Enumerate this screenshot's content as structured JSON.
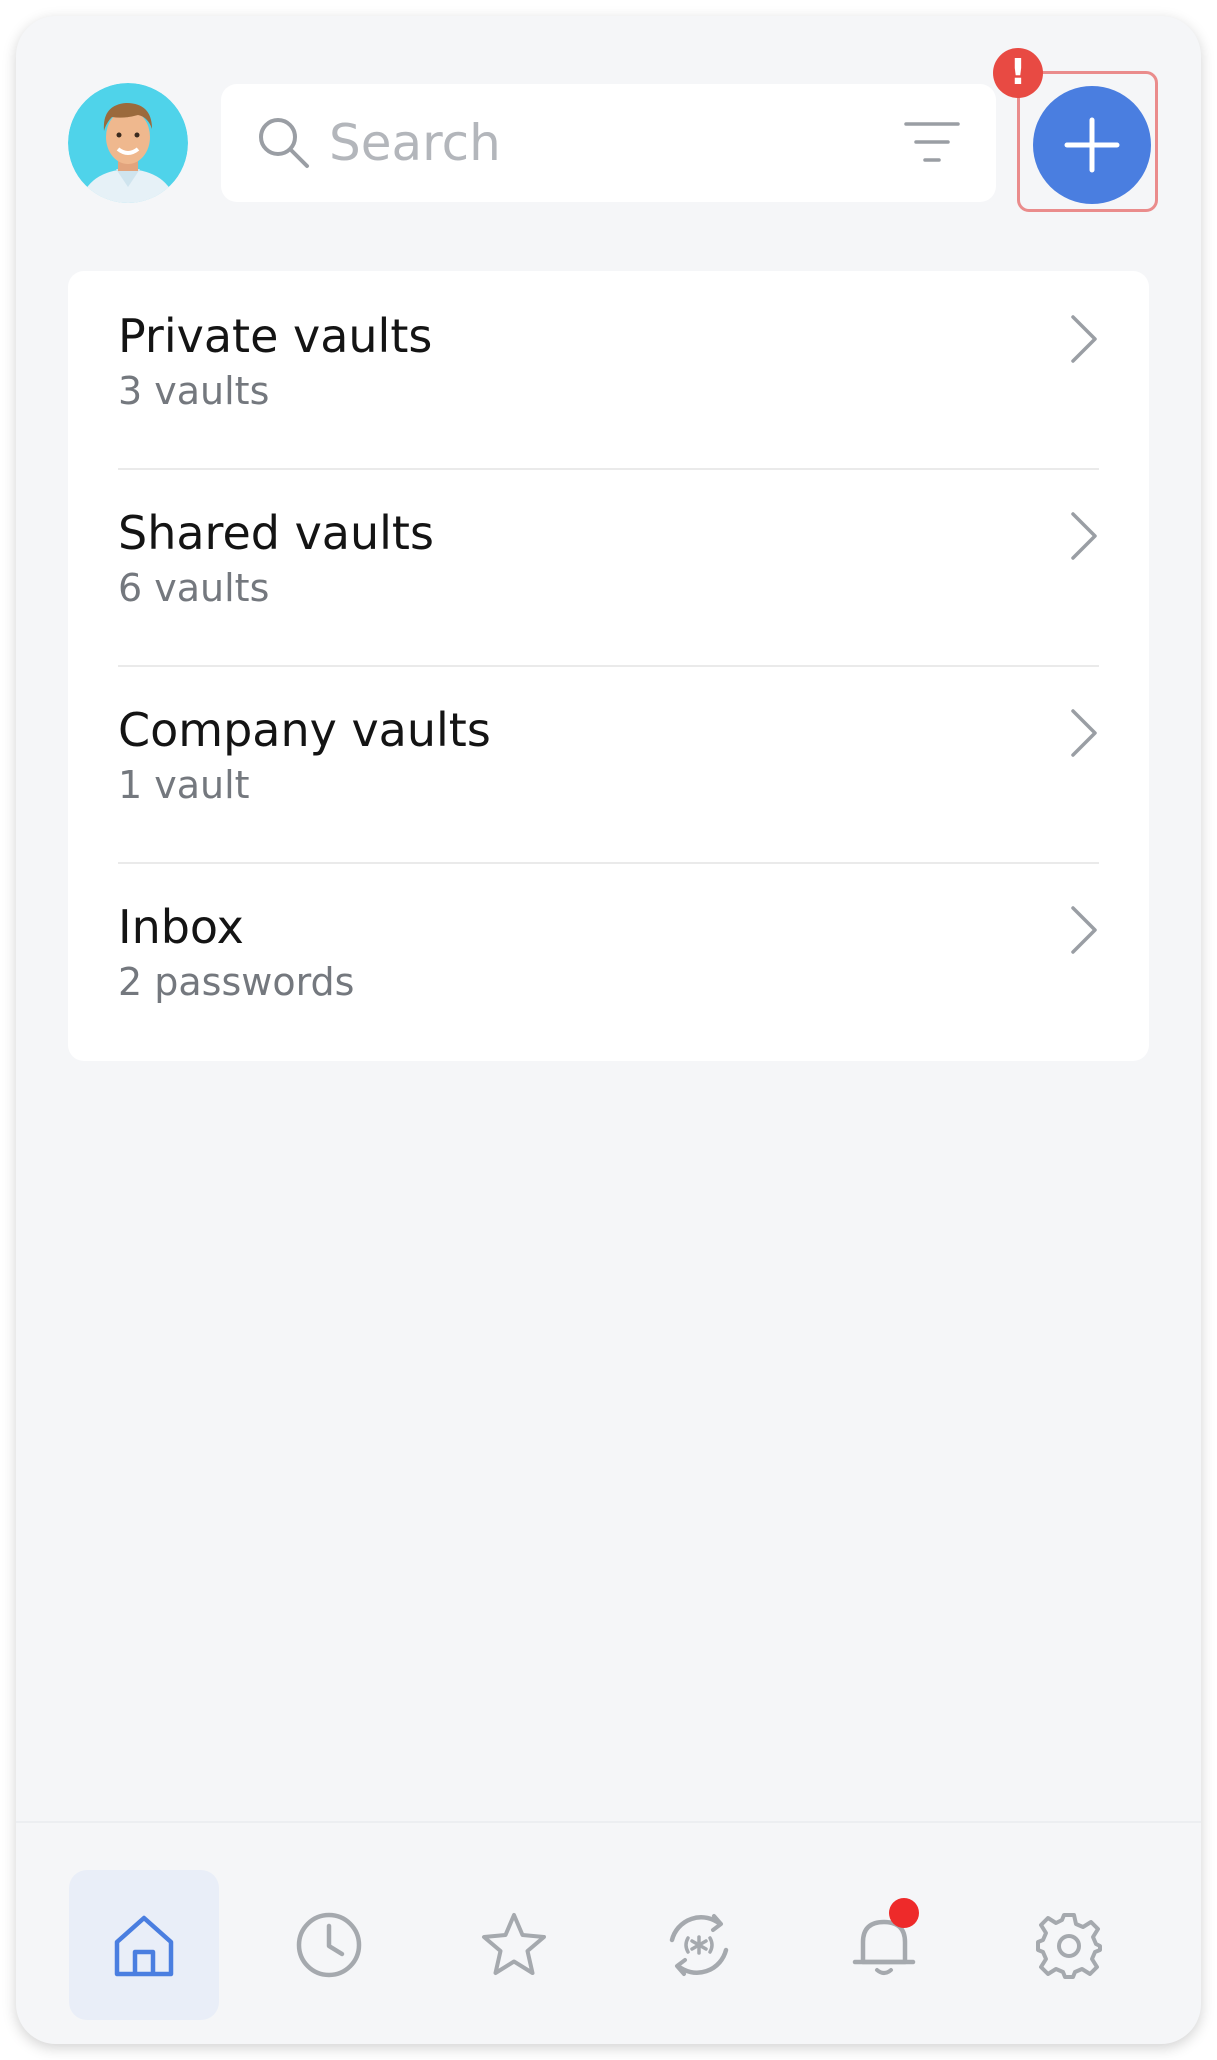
{
  "search": {
    "placeholder": "Search"
  },
  "add_button": {
    "label": "+"
  },
  "alert_badge": {
    "text": "!"
  },
  "vault_groups": [
    {
      "title": "Private vaults",
      "subtitle": "3 vaults"
    },
    {
      "title": "Shared vaults",
      "subtitle": "6 vaults"
    },
    {
      "title": "Company vaults",
      "subtitle": "1 vault"
    },
    {
      "title": "Inbox",
      "subtitle": "2 passwords"
    }
  ],
  "bottom_nav": [
    {
      "icon": "home-icon",
      "active": true
    },
    {
      "icon": "clock-icon",
      "active": false
    },
    {
      "icon": "star-icon",
      "active": false
    },
    {
      "icon": "generator-icon",
      "active": false
    },
    {
      "icon": "bell-icon",
      "active": false,
      "badge": true
    },
    {
      "icon": "gear-icon",
      "active": false
    }
  ],
  "colors": {
    "accent": "#4a7ee0",
    "alert": "#e84a43",
    "highlight_border": "#ea8c8c",
    "background": "#f5f6f8"
  }
}
